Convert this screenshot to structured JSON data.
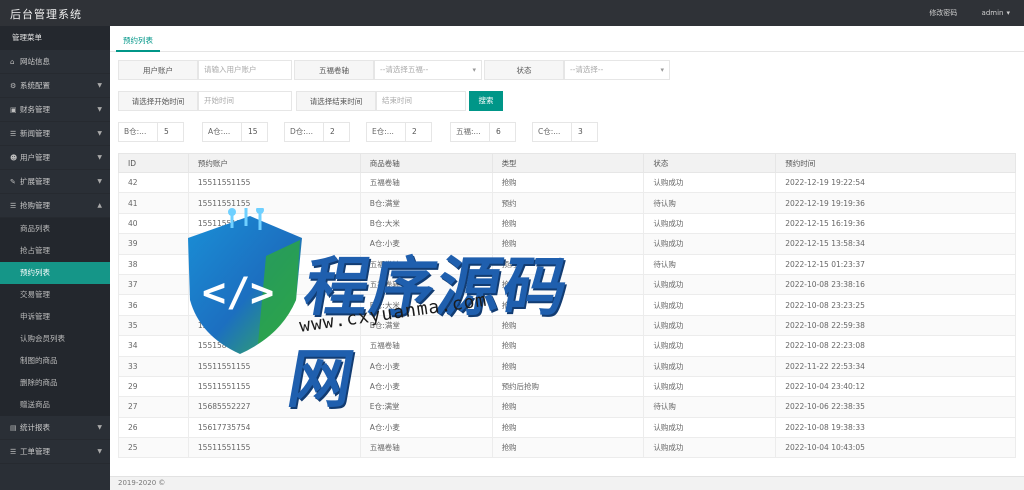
{
  "app_title": "后台管理系统",
  "topbar": {
    "change_password": "修改密码",
    "user": "admin"
  },
  "sidebar": {
    "header": "管理菜单",
    "items": [
      {
        "label": "网站信息",
        "icon": "home-icon",
        "arrow": false
      },
      {
        "label": "系统配置",
        "icon": "cogs-icon",
        "arrow": true
      },
      {
        "label": "财务管理",
        "icon": "wallet-icon",
        "arrow": true
      },
      {
        "label": "新闻管理",
        "icon": "list-icon",
        "arrow": true
      },
      {
        "label": "用户管理",
        "icon": "users-icon",
        "arrow": true
      },
      {
        "label": "扩展管理",
        "icon": "wrench-icon",
        "arrow": true
      },
      {
        "label": "抢购管理",
        "icon": "list-icon",
        "arrow": true,
        "expanded": true
      }
    ],
    "subitems": [
      "商品列表",
      "抢占管理",
      "预约列表",
      "交易管理",
      "申诉管理",
      "认购会员列表",
      "制图的商品",
      "删除的商品",
      "赠送商品"
    ],
    "active_subitem": "预约列表",
    "items_after": [
      {
        "label": "统计报表",
        "icon": "chart-icon",
        "arrow": true
      },
      {
        "label": "工单管理",
        "icon": "list-icon",
        "arrow": true
      }
    ]
  },
  "tab": {
    "label": "预约列表"
  },
  "filters": {
    "user_label": "用户账户",
    "user_placeholder": "请输入用户账户",
    "product_label": "五福卷轴",
    "product_placeholder": "--请选择五福--",
    "status_label": "状态",
    "status_placeholder": "--请选择--",
    "start_label": "请选择开始时间",
    "start_placeholder": "开始时间",
    "end_label": "请选择结束时间",
    "end_placeholder": "结束时间",
    "search_button": "搜索"
  },
  "stats": [
    {
      "label": "B仓:...",
      "value": "5"
    },
    {
      "label": "A仓:...",
      "value": "15"
    },
    {
      "label": "D仓:...",
      "value": "2"
    },
    {
      "label": "E仓:...",
      "value": "2"
    },
    {
      "label": "五福:...",
      "value": "6"
    },
    {
      "label": "C仓:...",
      "value": "3"
    }
  ],
  "table": {
    "headers": [
      "ID",
      "预约账户",
      "商品卷轴",
      "类型",
      "状态",
      "预约时间"
    ],
    "rows": [
      [
        "42",
        "15511551155",
        "五福卷轴",
        "抢购",
        "认购成功",
        "2022-12-19 19:22:54"
      ],
      [
        "41",
        "15511551155",
        "B仓:满堂",
        "预约",
        "待认购",
        "2022-12-19 19:19:36"
      ],
      [
        "40",
        "15511551155",
        "B仓:大米",
        "抢购",
        "认购成功",
        "2022-12-15 16:19:36"
      ],
      [
        "39",
        "15511551155",
        "A仓:小麦",
        "抢购",
        "认购成功",
        "2022-12-15 13:58:34"
      ],
      [
        "38",
        "15511551155",
        "五福卷轴",
        "预约",
        "待认购",
        "2022-12-15 01:23:37"
      ],
      [
        "37",
        "15511551155",
        "五福卷轴",
        "抢购",
        "认购成功",
        "2022-10-08 23:38:16"
      ],
      [
        "36",
        "15511551155",
        "B仓:大米",
        "抢购",
        "认购成功",
        "2022-10-08 23:23:25"
      ],
      [
        "35",
        "15511557755",
        "B仓:满堂",
        "抢购",
        "认购成功",
        "2022-10-08 22:59:38"
      ],
      [
        "34",
        "155158",
        "五福卷轴",
        "抢购",
        "认购成功",
        "2022-10-08 22:23:08"
      ],
      [
        "33",
        "15511551155",
        "A仓:小麦",
        "抢购",
        "认购成功",
        "2022-11-22 22:53:34"
      ],
      [
        "29",
        "15511551155",
        "A仓:小麦",
        "预约后抢购",
        "认购成功",
        "2022-10-04 23:40:12"
      ],
      [
        "27",
        "15685552227",
        "E仓:满堂",
        "抢购",
        "待认购",
        "2022-10-06 22:38:35"
      ],
      [
        "26",
        "15617735754",
        "A仓:小麦",
        "抢购",
        "认购成功",
        "2022-10-08 19:38:33"
      ],
      [
        "25",
        "15511551155",
        "五福卷轴",
        "抢购",
        "认购成功",
        "2022-10-04 10:43:05"
      ]
    ]
  },
  "footer": "2019-2020 ©",
  "watermark": {
    "brand": "程序源码网",
    "url": "www.cxyuanma.com"
  }
}
